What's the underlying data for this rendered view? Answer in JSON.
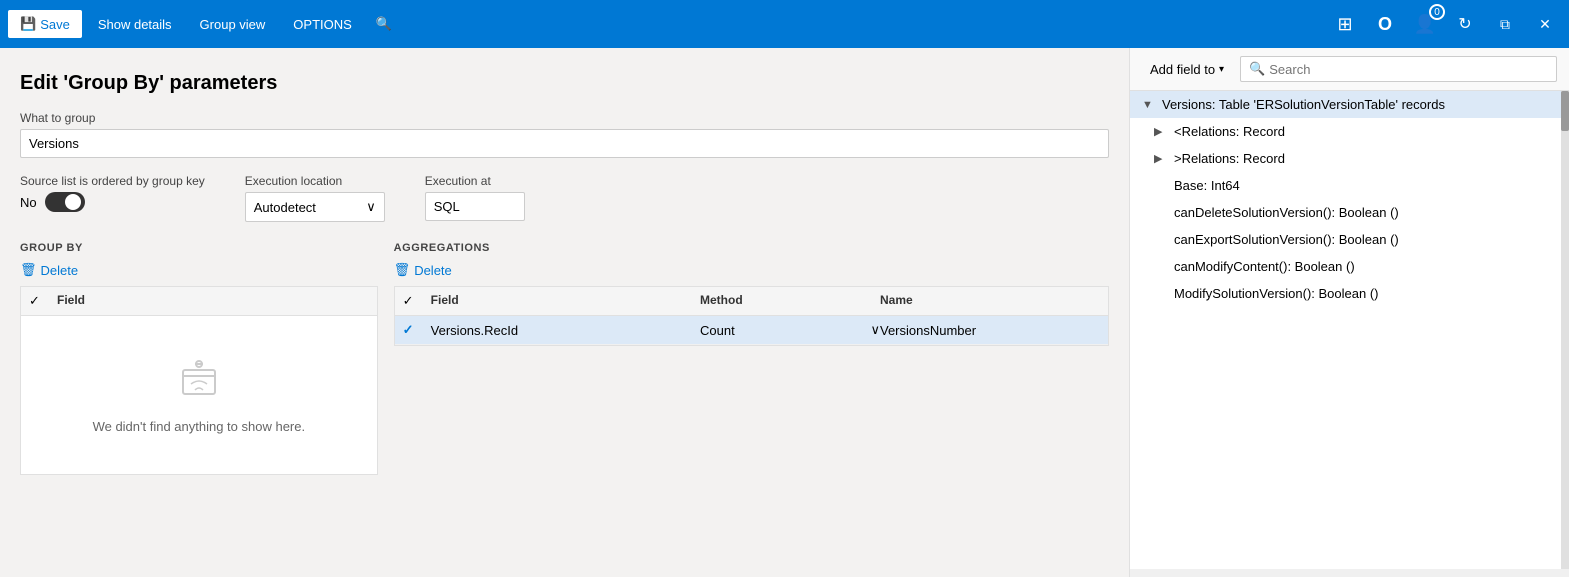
{
  "titleBar": {
    "save_label": "Save",
    "show_details_label": "Show details",
    "group_view_label": "Group view",
    "options_label": "OPTIONS",
    "badge_count": "0"
  },
  "page": {
    "title": "Edit 'Group By' parameters"
  },
  "form": {
    "what_to_group_label": "What to group",
    "what_to_group_value": "Versions",
    "source_ordered_label": "Source list is ordered by group key",
    "toggle_label": "No",
    "execution_location_label": "Execution location",
    "execution_location_value": "Autodetect",
    "execution_at_label": "Execution at",
    "execution_at_value": "SQL"
  },
  "groupBy": {
    "section_label": "GROUP BY",
    "delete_label": "Delete",
    "col_check": "",
    "col_field": "Field",
    "empty_message": "We didn't find anything to show here."
  },
  "aggregations": {
    "section_label": "AGGREGATIONS",
    "delete_label": "Delete",
    "col_check": "",
    "col_field": "Field",
    "col_method": "Method",
    "col_name": "Name",
    "rows": [
      {
        "field": "Versions.RecId",
        "method": "Count",
        "name": "VersionsNumber"
      }
    ]
  },
  "rightPanel": {
    "add_field_label": "Add field to",
    "search_placeholder": "Search",
    "search_label": "Search",
    "tree": [
      {
        "level": 0,
        "label": "Versions: Table 'ERSolutionVersionTable' records",
        "expanded": true,
        "selected": true
      },
      {
        "level": 1,
        "label": "<Relations: Record",
        "expanded": false,
        "selected": false
      },
      {
        "level": 1,
        "label": ">Relations: Record",
        "expanded": false,
        "selected": false
      },
      {
        "level": 1,
        "label": "Base: Int64",
        "expanded": false,
        "selected": false,
        "leaf": true
      },
      {
        "level": 1,
        "label": "canDeleteSolutionVersion(): Boolean ()",
        "expanded": false,
        "selected": false,
        "leaf": true
      },
      {
        "level": 1,
        "label": "canExportSolutionVersion(): Boolean ()",
        "expanded": false,
        "selected": false,
        "leaf": true
      },
      {
        "level": 1,
        "label": "canModifyContent(): Boolean ()",
        "expanded": false,
        "selected": false,
        "leaf": true
      },
      {
        "level": 1,
        "label": "ModifySolutionVersion(): Boolean ()",
        "expanded": false,
        "selected": false,
        "leaf": true
      }
    ]
  },
  "icons": {
    "save": "💾",
    "delete_trash": "🗑",
    "chevron_down": "∨",
    "chevron_right": "❯",
    "triangle_right": "▶",
    "triangle_down": "▼",
    "search": "🔍",
    "grid": "⊞",
    "office": "O",
    "profile": "👤",
    "refresh": "↻",
    "restore": "⧉",
    "close": "✕"
  }
}
